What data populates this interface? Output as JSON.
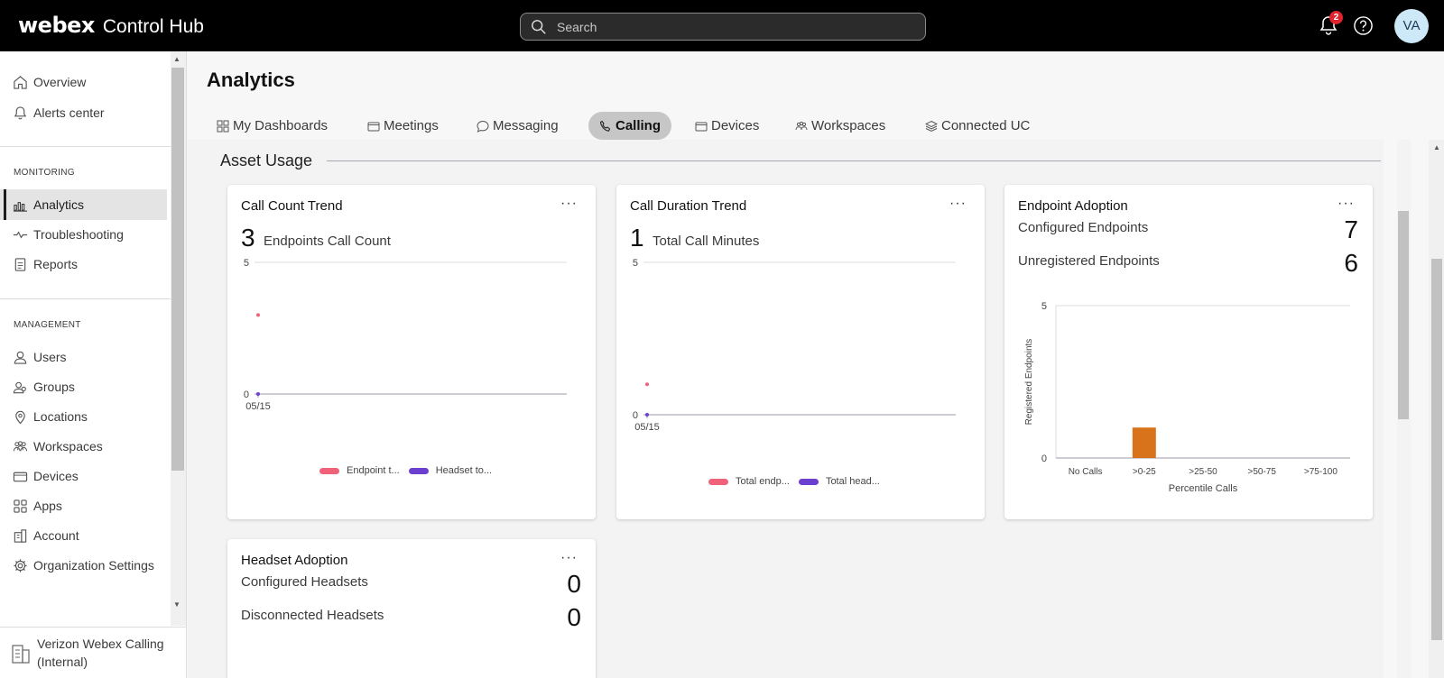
{
  "header": {
    "logo": "webex",
    "product": "Control Hub",
    "search_placeholder": "Search",
    "notifications_count": "2",
    "avatar_initials": "VA"
  },
  "sidebar": {
    "top_items": [
      {
        "label": "Overview",
        "icon": "home-icon"
      },
      {
        "label": "Alerts center",
        "icon": "bell-icon"
      }
    ],
    "monitoring_label": "MONITORING",
    "monitoring_items": [
      {
        "label": "Analytics",
        "icon": "analytics-icon",
        "active": true
      },
      {
        "label": "Troubleshooting",
        "icon": "pulse-icon"
      },
      {
        "label": "Reports",
        "icon": "report-icon"
      }
    ],
    "management_label": "MANAGEMENT",
    "management_items": [
      {
        "label": "Users",
        "icon": "user-icon"
      },
      {
        "label": "Groups",
        "icon": "group-icon"
      },
      {
        "label": "Locations",
        "icon": "location-icon"
      },
      {
        "label": "Workspaces",
        "icon": "workspaces-icon"
      },
      {
        "label": "Devices",
        "icon": "devices-icon"
      },
      {
        "label": "Apps",
        "icon": "apps-icon"
      },
      {
        "label": "Account",
        "icon": "account-icon"
      },
      {
        "label": "Organization Settings",
        "icon": "gear-icon"
      }
    ],
    "org_name": "Verizon Webex Calling (Internal)"
  },
  "main": {
    "title": "Analytics",
    "tabs": [
      {
        "label": "My Dashboards",
        "icon": "dashboard-icon"
      },
      {
        "label": "Meetings",
        "icon": "meetings-icon"
      },
      {
        "label": "Messaging",
        "icon": "message-icon"
      },
      {
        "label": "Calling",
        "icon": "phone-icon",
        "active": true
      },
      {
        "label": "Devices",
        "icon": "devices-icon"
      },
      {
        "label": "Workspaces",
        "icon": "workspaces-icon"
      },
      {
        "label": "Connected UC",
        "icon": "stack-icon"
      }
    ],
    "section_title": "Asset Usage"
  },
  "cards": {
    "call_count": {
      "title": "Call Count Trend",
      "menu": "···",
      "value": "3",
      "value_label": "Endpoints Call Count"
    },
    "call_duration": {
      "title": "Call Duration Trend",
      "menu": "···",
      "value": "1",
      "value_label": "Total Call Minutes"
    },
    "endpoint_adoption": {
      "title": "Endpoint Adoption",
      "menu": "···",
      "configured_label": "Configured Endpoints",
      "configured_value": "7",
      "unregistered_label": "Unregistered Endpoints",
      "unregistered_value": "6"
    },
    "headset_adoption": {
      "title": "Headset Adoption",
      "menu": "···",
      "configured_label": "Configured Headsets",
      "configured_value": "0",
      "disconnected_label": "Disconnected Headsets",
      "disconnected_value": "0"
    }
  },
  "chart_data": [
    {
      "type": "scatter",
      "x": [
        "05/15"
      ],
      "series": [
        {
          "name": "Endpoint t...",
          "values": [
            3
          ],
          "color": "#f0617a"
        },
        {
          "name": "Headset to...",
          "values": [
            0
          ],
          "color": "#6b3fd0"
        }
      ],
      "ylim": [
        0,
        5
      ],
      "yticks": [
        "0",
        "5"
      ],
      "legend": "bottom"
    },
    {
      "type": "scatter",
      "x": [
        "05/15"
      ],
      "series": [
        {
          "name": "Total endp...",
          "values": [
            1
          ],
          "color": "#f0617a"
        },
        {
          "name": "Total head...",
          "values": [
            0
          ],
          "color": "#6b3fd0"
        }
      ],
      "ylim": [
        0,
        5
      ],
      "yticks": [
        "0",
        "5"
      ],
      "legend": "bottom"
    },
    {
      "type": "bar",
      "categories": [
        "No Calls",
        ">0-25",
        ">25-50",
        ">50-75",
        ">75-100"
      ],
      "values": [
        0,
        1,
        0,
        0,
        0
      ],
      "xlabel": "Percentile Calls",
      "ylabel": "Registered Endpoints",
      "ylim": [
        0,
        5
      ],
      "yticks": [
        "0",
        "5"
      ],
      "color": "#d9731b"
    }
  ]
}
